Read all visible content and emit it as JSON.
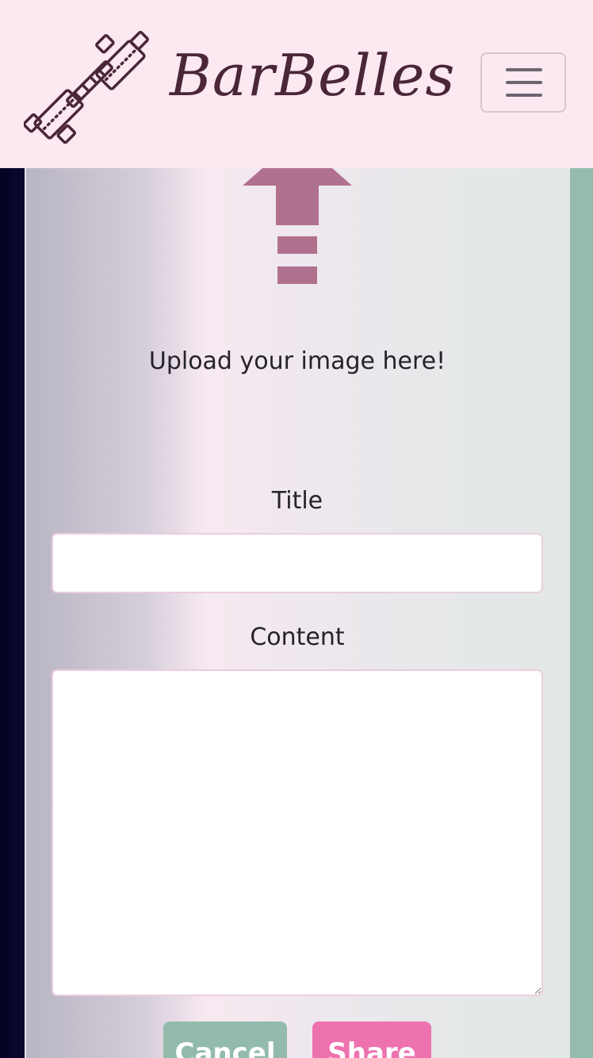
{
  "navbar": {
    "brand_name": "BarBelles",
    "brand_logo_icon": "dumbbell-icon",
    "toggler_icon": "hamburger-menu-icon",
    "background_color": "#fbe8f1",
    "brand_color": "#4a2637"
  },
  "upload": {
    "icon": "upload-arrow-icon",
    "text": "Upload your image here!",
    "icon_color": "#b0718f"
  },
  "form": {
    "title_label": "Title",
    "title_value": "",
    "content_label": "Content",
    "content_value": ""
  },
  "actions": {
    "cancel_label": "Cancel",
    "share_label": "Share",
    "cancel_color": "#93bbab",
    "share_color": "#ee72b0"
  }
}
